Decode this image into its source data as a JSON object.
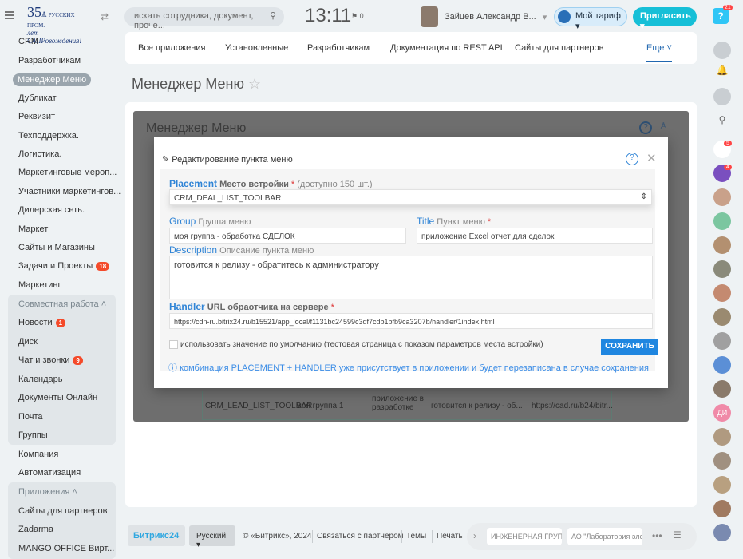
{
  "header": {
    "logo_text": "350 лет САПРовождения",
    "logo_sub": "Русских промышленных компаний",
    "search_placeholder": "искать сотрудника, документ, проче...",
    "time": "13:11",
    "flag_count": "0",
    "user_name": "Зайцев Александр В...",
    "tariff": "Мой тариф",
    "invite": "Пригласить",
    "help_badge": "21"
  },
  "sidebar": {
    "items": [
      {
        "label": "CRM"
      },
      {
        "label": "Разработчикам"
      },
      {
        "label": "Менеджер Меню"
      },
      {
        "label": "Дубликат"
      },
      {
        "label": "Реквизит"
      },
      {
        "label": "Техподдержка."
      },
      {
        "label": "Логистика."
      },
      {
        "label": "Маркетинговые мероп..."
      },
      {
        "label": "Участники маркетингов..."
      },
      {
        "label": "Дилерская сеть."
      },
      {
        "label": "Маркет"
      },
      {
        "label": "Сайты и Магазины"
      },
      {
        "label": "Задачи и Проекты",
        "count": "18"
      },
      {
        "label": "Маркетинг"
      }
    ],
    "group1": {
      "label": "Совместная работа",
      "items": [
        {
          "label": "Новости",
          "count": "1"
        },
        {
          "label": "Диск"
        },
        {
          "label": "Чат и звонки",
          "count": "9"
        },
        {
          "label": "Календарь"
        },
        {
          "label": "Документы Онлайн"
        },
        {
          "label": "Почта"
        },
        {
          "label": "Группы"
        }
      ]
    },
    "mid": [
      {
        "label": "Компания"
      },
      {
        "label": "Автоматизация"
      }
    ],
    "group2": {
      "label": "Приложения",
      "items": [
        {
          "label": "Сайты для партнеров"
        },
        {
          "label": "Zadarma"
        },
        {
          "label": "MANGO OFFICE Вирт..."
        }
      ]
    }
  },
  "tabs": [
    "Все приложения",
    "Установленные",
    "Разработчикам",
    "Документация по REST API",
    "Сайты для партнеров",
    "Еще"
  ],
  "page_title": "Менеджер Меню",
  "inner_title": "Менеджер Меню",
  "bg_row": [
    "CRM_LEAD_LIST_TOOLBAR",
    "моя группа 1",
    "приложение в разработке",
    "готовится к релизу - об...",
    "https://cad.ru/b24/bitr..."
  ],
  "dialog": {
    "title": "Редактирование пункта меню",
    "placement": {
      "en": "Placement",
      "ru": "Место встройки",
      "note": "(доступно 150 шт.)",
      "value": "CRM_DEAL_LIST_TOOLBAR"
    },
    "group": {
      "en": "Group",
      "ru": "Группа меню",
      "value": "моя группа - обработка СДЕЛОК"
    },
    "title_field": {
      "en": "Title",
      "ru": "Пункт меню",
      "value": "приложение Excel отчет для сделок"
    },
    "description": {
      "en": "Description",
      "ru": "Описание пункта меню",
      "value": "готовится к релизу - обратитесь к администратору"
    },
    "handler": {
      "en": "Handler",
      "ru": "URL обраотчика на сервере",
      "value": "https://cdn-ru.bitrix24.ru/b15521/app_local/f1131bc24599c3df7cdb1bfb9ca3207b/handler/1index.html"
    },
    "default_checkbox": "использовать значение по умолчанию (тестовая страница с показом параметров места встройки)",
    "save": "СОХРАНИТЬ",
    "info": "комбинация PLACEMENT + HANDLER уже присутствует в приложении и будет перезаписана в случае сохранения"
  },
  "rightbar": {
    "badge1": "5",
    "badge2": "4",
    "initials": "ДИ"
  },
  "footer": {
    "brand": "Битрикс24",
    "lang": "Русский",
    "copyright": "© «Битрикс», 2024",
    "partner": "Связаться с партнером",
    "themes": "Темы",
    "print": "Печать",
    "task1": "ИНЖЕНЕРНАЯ ГРУПП...",
    "task2": "АО \"Лаборатория эле..."
  }
}
